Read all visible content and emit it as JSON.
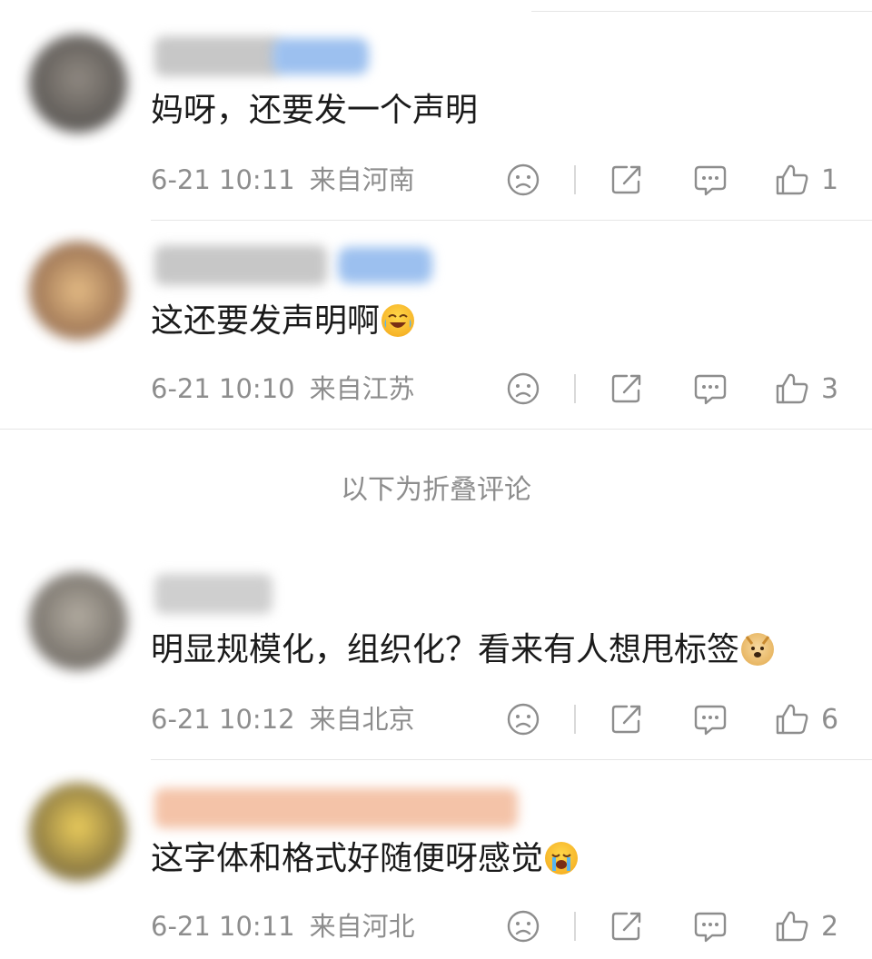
{
  "comments": [
    {
      "text": "妈呀，还要发一个声明",
      "time": "6-21 10:11",
      "location": "来自河南",
      "likes": "1",
      "emoji": "",
      "avatar_color": "#5a5550",
      "name_color": "#bdbdbd",
      "tag_color": "#7aa8e8"
    },
    {
      "text": "这还要发声明啊",
      "time": "6-21 10:10",
      "location": "来自江苏",
      "likes": "3",
      "emoji": "laughing-crying-emoji",
      "avatar_color": "#b98a5e",
      "name_color": "#bdbdbd",
      "tag_color": "#7aa8e8"
    },
    {
      "text": "明显规模化，组织化？看来有人想甩标签",
      "time": "6-21 10:12",
      "location": "来自北京",
      "likes": "6",
      "emoji": "doge-emoji",
      "avatar_color": "#8a8378",
      "name_color": "#c4c4c4",
      "tag_color": ""
    },
    {
      "text": "这字体和格式好随便呀感觉",
      "time": "6-21 10:11",
      "location": "来自河北",
      "likes": "2",
      "emoji": "crying-emoji",
      "avatar_color": "#a88a2e",
      "name_color": "#f0b89a",
      "tag_color": ""
    }
  ],
  "folded_label": "以下为折叠评论",
  "icons": {
    "dislike": "sad-face-icon",
    "share": "share-icon",
    "comment": "comment-bubble-icon",
    "like": "thumbs-up-icon"
  }
}
